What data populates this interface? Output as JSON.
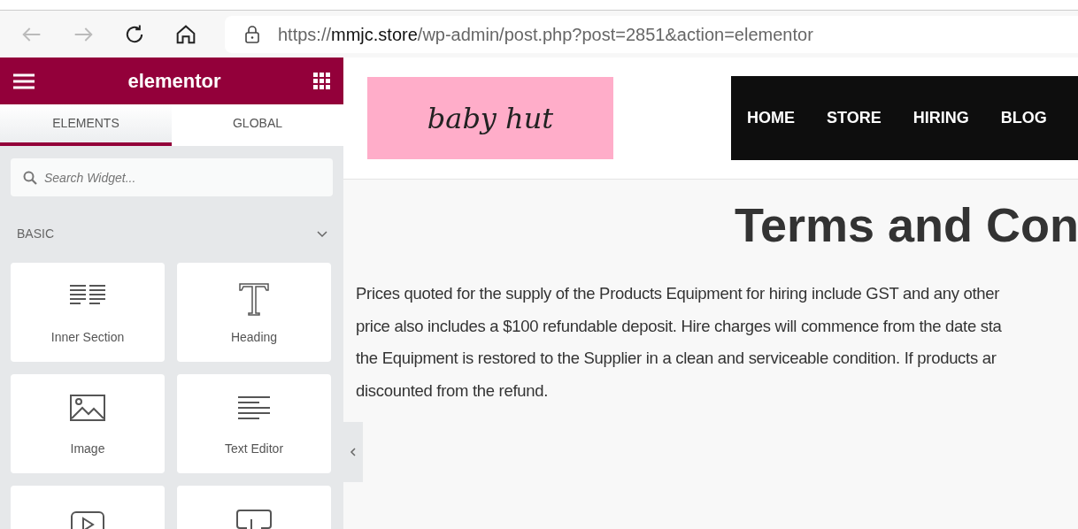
{
  "browser": {
    "url_scheme": "https://",
    "url_host": "mmjc.store",
    "url_path": "/wp-admin/post.php?post=2851&action=elementor",
    "back_disabled": true,
    "forward_disabled": true
  },
  "panel": {
    "brand": "elementor",
    "tabs": [
      {
        "label": "ELEMENTS",
        "selected": true
      },
      {
        "label": "GLOBAL",
        "selected": false
      }
    ],
    "search": {
      "placeholder": "Search Widget..."
    },
    "category": {
      "label": "BASIC",
      "expanded": true
    },
    "widgets": [
      {
        "kind": "columns",
        "label": "Inner Section"
      },
      {
        "kind": "heading",
        "label": "Heading"
      },
      {
        "kind": "image",
        "label": "Image"
      },
      {
        "kind": "text",
        "label": "Text Editor"
      },
      {
        "kind": "video"
      },
      {
        "kind": "button"
      }
    ]
  },
  "site": {
    "logo": "baby hut",
    "menu": [
      "HOME",
      "STORE",
      "HIRING",
      "BLOG"
    ],
    "title": "Terms and Con",
    "paragraph_lines": [
      "Prices quoted for the supply of the Products Equipment for hiring include GST and any other",
      "price also includes a $100 refundable deposit. Hire charges will commence from the date sta",
      "the Equipment is restored to the Supplier in a clean and serviceable condition. If products ar",
      "discounted from the refund."
    ]
  }
}
